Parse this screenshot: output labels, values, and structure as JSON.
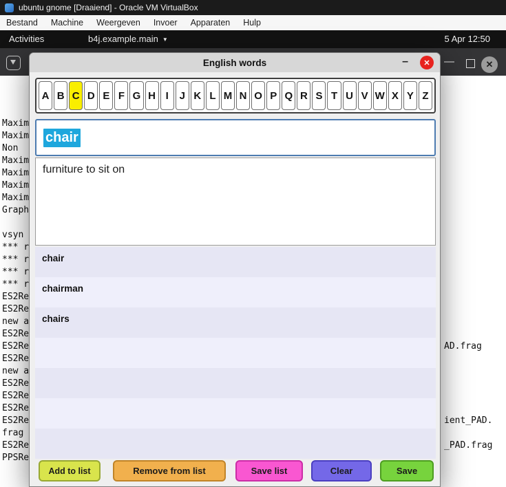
{
  "window": {
    "title": "ubuntu gnome [Draaiend] - Oracle VM VirtualBox"
  },
  "menubar": {
    "items": [
      "Bestand",
      "Machine",
      "Weergeven",
      "Invoer",
      "Apparaten",
      "Hulp"
    ]
  },
  "topbar": {
    "activities": "Activities",
    "focused_app": "b4j.example.main",
    "caret": "▼",
    "clock": "5 Apr 12:50"
  },
  "terminal": {
    "controls": {
      "minimize": "—",
      "close": "✕"
    },
    "left_lines": [
      "Maxim",
      "Maxim",
      "Non",
      "Maxim",
      "Maxim",
      "Maxim",
      "Maxim",
      "Graph",
      "",
      "vsyn",
      "*** r",
      "*** r",
      "*** r",
      "*** r",
      "ES2Re",
      "ES2Re",
      "new a",
      "ES2Re",
      "ES2Re",
      "ES2Re",
      "new a",
      "ES2Re",
      "ES2Re",
      "ES2Re",
      "ES2Re",
      "frag",
      "ES2Re",
      "PPSRe"
    ],
    "right_fragments": [
      {
        "text": "AD.frag",
        "row": 18
      },
      {
        "text": "ient_PAD.",
        "row": 24
      },
      {
        "text": "_PAD.frag",
        "row": 26
      }
    ]
  },
  "dialog": {
    "title": "English words",
    "minimize_glyph": "–",
    "close_glyph": "✕",
    "alphabet": [
      "A",
      "B",
      "C",
      "D",
      "E",
      "F",
      "G",
      "H",
      "I",
      "J",
      "K",
      "L",
      "M",
      "N",
      "O",
      "P",
      "Q",
      "R",
      "S",
      "T",
      "U",
      "V",
      "W",
      "X",
      "Y",
      "Z"
    ],
    "active_letter": "C",
    "word": "chair",
    "definition": "furniture to sit on",
    "list": {
      "items": [
        "chair",
        "chairman",
        "chairs"
      ],
      "row_count": 7
    },
    "buttons": [
      {
        "id": "add",
        "label": "Add to list",
        "bg": "#d9e44c",
        "border": "#98a832"
      },
      {
        "id": "remove",
        "label": "Remove from list",
        "bg": "#f1b04d",
        "border": "#c08428"
      },
      {
        "id": "save-list",
        "label": "Save list",
        "bg": "#f957d1",
        "border": "#cb2da6"
      },
      {
        "id": "clear",
        "label": "Clear",
        "bg": "#7468e8",
        "border": "#4a3fc0"
      },
      {
        "id": "save",
        "label": "Save",
        "bg": "#77d33d",
        "border": "#4d9d20"
      }
    ],
    "colors": {
      "selection_bg": "#1ea7dd",
      "selection_text": "#ffffff",
      "active_key_bg": "#f9ee00"
    }
  }
}
